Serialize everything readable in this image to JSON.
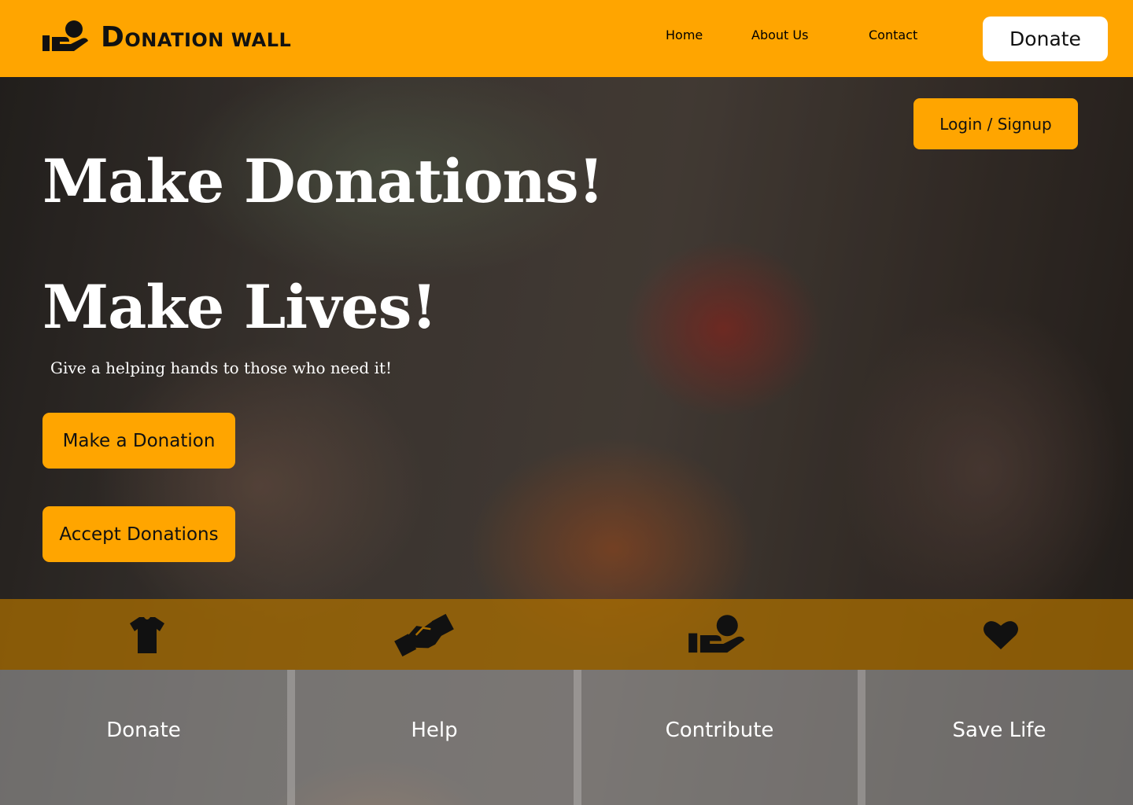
{
  "header": {
    "brand": {
      "first_letter": "D",
      "rest": "ONATION WALL"
    },
    "nav": [
      "Home",
      "About Us",
      "Contact"
    ],
    "donate_label": "Donate",
    "background_color": "#ffa500"
  },
  "hero": {
    "login_label": "Login / Signup",
    "headline_1": "Make Donations!",
    "headline_2": "Make Lives!",
    "tagline": "Give a helping hands to those who need it!",
    "cta_primary": "Make a Donation",
    "cta_secondary": "Accept Donations",
    "accent_color": "#ffa500"
  },
  "features": [
    {
      "label": "Donate",
      "icon": "tshirt-icon"
    },
    {
      "label": "Help",
      "icon": "handshake-icon"
    },
    {
      "label": "Contribute",
      "icon": "hand-holding-icon"
    },
    {
      "label": "Save Life",
      "icon": "heart-icon"
    }
  ]
}
